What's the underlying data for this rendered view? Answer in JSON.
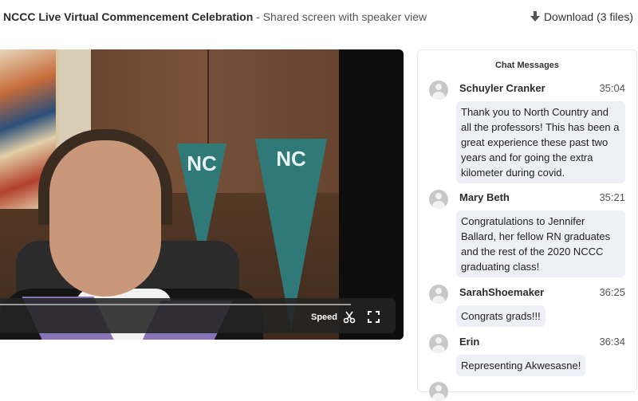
{
  "header": {
    "title": "NCCC Live Virtual Commencement Celebration",
    "subtitle": "- Shared screen with speaker view",
    "download_icon": "download-arrow-icon",
    "download_label": "Download (3 files)"
  },
  "video": {
    "pennant_small_text": "NC",
    "pennant_large_text": "NC",
    "speed_label": "Speed",
    "scissors_icon": "scissors-icon",
    "fullscreen_icon": "fullscreen-icon"
  },
  "chat": {
    "header": "Chat Messages",
    "messages": [
      {
        "sender": "Schuyler Cranker",
        "time": "35:04",
        "text": "Thank you to North Country and all the professors! This has been a great experience these past two years and for going the extra kilometer during covid."
      },
      {
        "sender": "Mary Beth",
        "time": "35:21",
        "text": "Congratulations to Jennifer Ballard, her fellow RN graduates and the rest of the 2020 NCCC graduating class!"
      },
      {
        "sender": "SarahShoemaker",
        "time": "36:25",
        "text": "Congrats grads!!!"
      },
      {
        "sender": "Erin",
        "time": "36:34",
        "text": "Representing Akwesasne!"
      }
    ]
  },
  "colors": {
    "bubble_bg": "#eff0f7",
    "pennant": "#2f7a78",
    "gown_stripe": "#8a74b8"
  }
}
